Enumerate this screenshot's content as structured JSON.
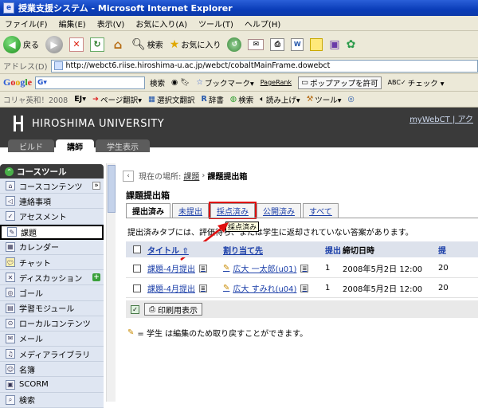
{
  "window": {
    "title": "授業支援システム - Microsoft Internet Explorer"
  },
  "menu": [
    "ファイル(F)",
    "編集(E)",
    "表示(V)",
    "お気に入り(A)",
    "ツール(T)",
    "ヘルプ(H)"
  ],
  "toolbar": {
    "back": "戻る",
    "search": "検索",
    "favorites": "お気に入り"
  },
  "address": {
    "label": "アドレス(D)",
    "url": "http://webct6.riise.hiroshima-u.ac.jp/webct/cobaltMainFrame.dowebct"
  },
  "google": {
    "logo": "Google",
    "field": "G▾",
    "search": "検索",
    "bookmark": "ブックマーク▾",
    "pagerank": "PageRank",
    "popup": "ポップアップを許可",
    "check": "チェック ▾"
  },
  "links": {
    "dict": "コリャ英和！2008",
    "ej": "EJ▾",
    "page_translate": "ページ翻訳▾",
    "select_translate": "選択文翻訳",
    "jisho": "辞書",
    "kensaku": "検索",
    "yomiage": "読み上げ▾",
    "tools": "ツール▾"
  },
  "banner": {
    "university": "HIROSHIMA UNIVERSITY",
    "mywebct": "myWebCT",
    "extra": "| アク",
    "tabs": [
      "ビルド",
      "講師",
      "学生表示"
    ]
  },
  "sidebar": {
    "title": "コースツール",
    "items": [
      "コースコンテンツ",
      "連絡事項",
      "アセスメント",
      "課題",
      "カレンダー",
      "チャット",
      "ディスカッション",
      "ゴール",
      "学習モジュール",
      "ローカルコンテンツ",
      "メール",
      "メディアライブラリ",
      "名簿",
      "SCORM",
      "検索"
    ]
  },
  "main": {
    "breadcrumb": {
      "prefix": "現在の場所:",
      "link": "課題",
      "sep": "›",
      "current": "課題提出箱"
    },
    "title": "課題提出箱",
    "tabs": [
      "提出済み",
      "未提出",
      "採点済み",
      "公開済み",
      "すべて"
    ],
    "tooltip": "採点済み",
    "note": "提出済みタブには、評価待ち、または学生に返却されていない答案があります。",
    "columns": {
      "title": "タイトル ⇧",
      "assigned": "割り当て先",
      "submitted": "提出",
      "due": "締切日時",
      "more": "提"
    },
    "rows": [
      {
        "title": "課題-4月提出",
        "assignee": "広大 一太郎(u01)",
        "count": "1",
        "due": "2008年5月2日 12:00",
        "more": "20"
      },
      {
        "title": "課題-4月提出",
        "assignee": "広大 すみれ(u04)",
        "count": "1",
        "due": "2008年5月2日 12:00",
        "more": "20"
      }
    ],
    "print": "印刷用表示",
    "footnote": "= 学生 は編集のため取り戻すことができます。"
  },
  "colors": {
    "highlight": "#e01010",
    "banner": "#3a3a3a",
    "link": "#1a3ea8"
  }
}
